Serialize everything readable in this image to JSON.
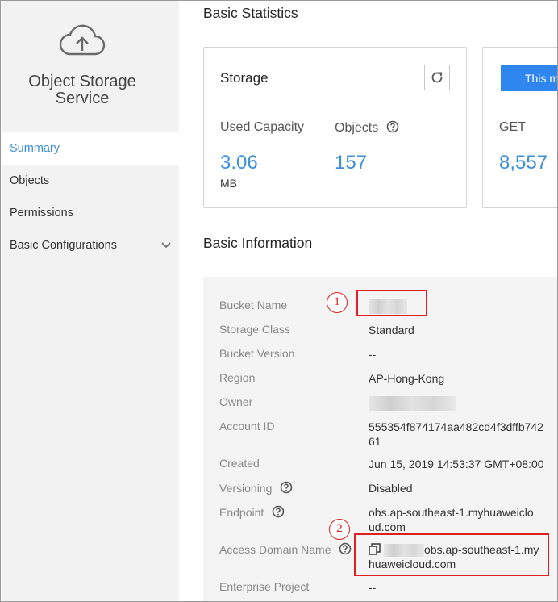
{
  "sidebar": {
    "service_title": "Object Storage Service",
    "items": [
      {
        "label": "Summary",
        "active": true
      },
      {
        "label": "Objects"
      },
      {
        "label": "Permissions"
      },
      {
        "label": "Basic Configurations"
      }
    ]
  },
  "statistics": {
    "section_title": "Basic Statistics",
    "storage_card": {
      "title": "Storage",
      "used_capacity_label": "Used Capacity",
      "used_capacity_value": "3.06",
      "used_capacity_unit": "MB",
      "objects_label": "Objects",
      "objects_value": "157"
    },
    "requests_card": {
      "button_label": "This m",
      "get_label": "GET",
      "get_value": "8,557"
    }
  },
  "info": {
    "section_title": "Basic Information",
    "bucket_name_label": "Bucket Name",
    "storage_class_label": "Storage Class",
    "storage_class_value": "Standard",
    "bucket_version_label": "Bucket Version",
    "bucket_version_value": "--",
    "region_label": "Region",
    "region_value": "AP-Hong-Kong",
    "owner_label": "Owner",
    "account_id_label": "Account ID",
    "account_id_value": "555354f874174aa482cd4f3dffb74261",
    "created_label": "Created",
    "created_value": "Jun 15, 2019 14:53:37 GMT+08:00",
    "versioning_label": "Versioning",
    "versioning_value": "Disabled",
    "endpoint_label": "Endpoint",
    "endpoint_value": "obs.ap-southeast-1.myhuaweicloud.com",
    "access_domain_label": "Access Domain Name",
    "access_domain_value": "obs.ap-southeast-1.myhuaweicloud.com",
    "enterprise_project_label": "Enterprise Project",
    "enterprise_project_value": "--"
  },
  "annotations": {
    "one": "1",
    "two": "2"
  },
  "colors": {
    "accent": "#3c8fd8",
    "annotation": "#e02020",
    "button": "#2f86ee"
  },
  "icons": [
    "cloud-upload-icon",
    "chevron-down-icon",
    "refresh-icon",
    "help-icon",
    "copy-icon"
  ]
}
